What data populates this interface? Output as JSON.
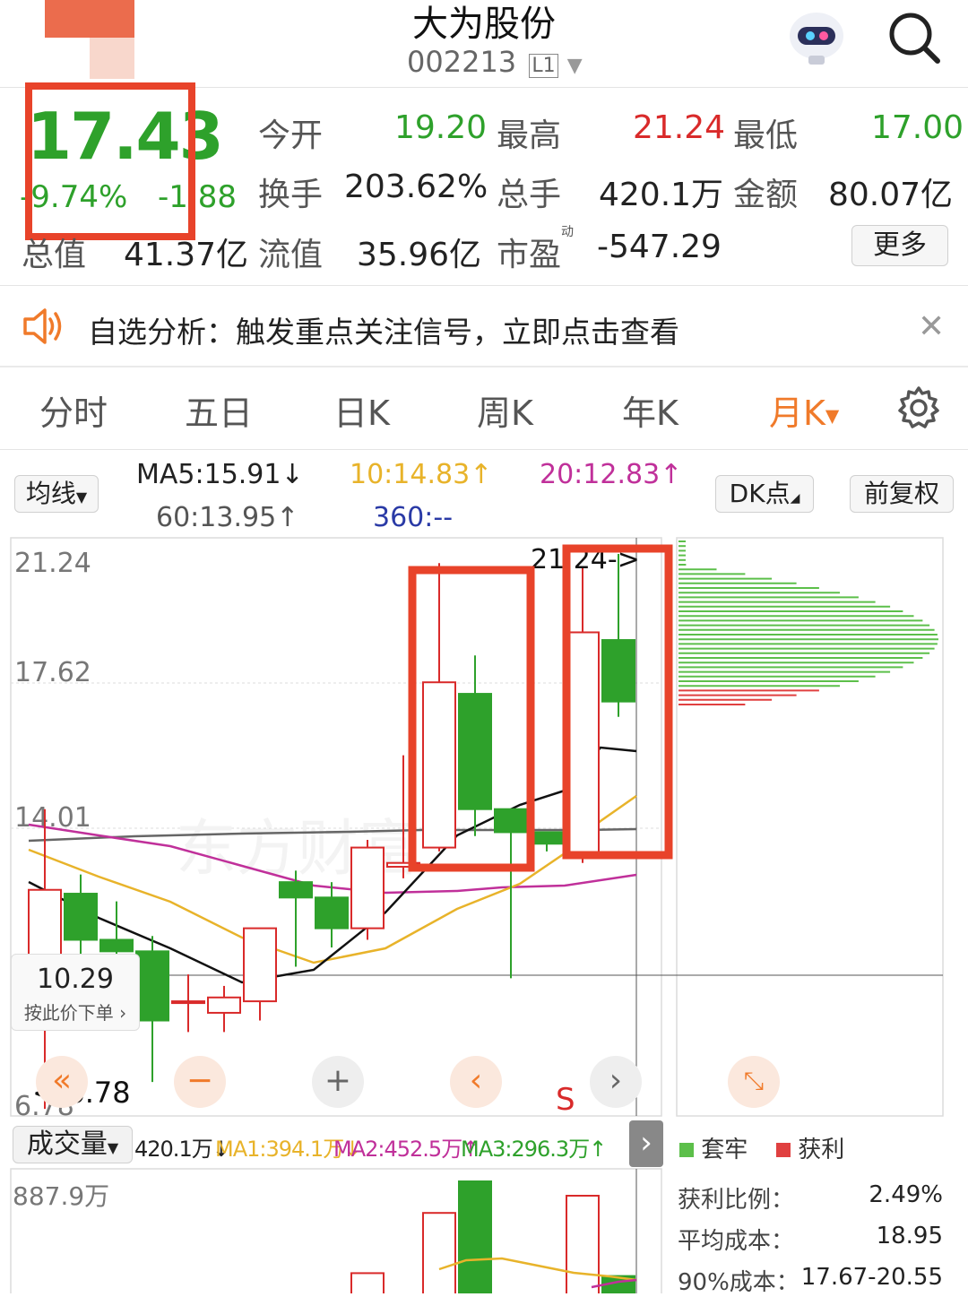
{
  "header": {
    "title": "大为股份",
    "code": "002213",
    "level_badge": "L1"
  },
  "quote": {
    "price": "17.43",
    "change_pct": "-9.74%",
    "change": "-1.88",
    "stats": [
      {
        "label": "今开",
        "value": "19.20",
        "color": "green"
      },
      {
        "label": "最高",
        "value": "21.24",
        "color": "red"
      },
      {
        "label": "最低",
        "value": "17.00",
        "color": "green"
      },
      {
        "label": "换手",
        "value": "203.62%",
        "color": "black"
      },
      {
        "label": "总手",
        "value": "420.1万",
        "color": "black"
      },
      {
        "label": "金额",
        "value": "80.07亿",
        "color": "black"
      },
      {
        "label": "总值",
        "value": "41.37亿",
        "color": "black"
      },
      {
        "label": "流值",
        "value": "35.96亿",
        "color": "black"
      },
      {
        "label": "市盈",
        "value": "-547.29",
        "color": "black"
      }
    ],
    "pe_superscript": "动",
    "more_label": "更多"
  },
  "notice": {
    "text": "自选分析：触发重点关注信号，立即点击查看"
  },
  "tabs": [
    "分时",
    "五日",
    "日K",
    "周K",
    "年K",
    "月K"
  ],
  "active_tab": "月K",
  "indicator_bar": {
    "ma_selector": "均线",
    "ma5": "MA5:15.91↓",
    "ma10": "10:14.83↑",
    "ma20": "20:12.83↑",
    "ma60": "60:13.95↑",
    "ma360": "360:--",
    "dk_label": "DK点",
    "adjust_label": "前复权"
  },
  "chart": {
    "y_labels": [
      "21.24",
      "17.62",
      "14.01",
      "6.78"
    ],
    "high_marker": "21.24->",
    "low_marker": "<-6.78",
    "watermark": "东方财富",
    "tooltip_price": "10.29",
    "tooltip_action": "按此价下单",
    "s_marker": "S"
  },
  "volume": {
    "selector": "成交量",
    "vol": "420.1万↓",
    "ma1": "MA1:394.1万↓",
    "ma2": "MA2:452.5万↑",
    "ma3": "MA3:296.3万↑",
    "max_label": "887.9万"
  },
  "chip": {
    "legend_trapped": "套牢",
    "legend_profit": "获利",
    "rows": [
      {
        "label": "获利比例：",
        "value": "2.49%"
      },
      {
        "label": "平均成本：",
        "value": "18.95"
      },
      {
        "label": "90%成本：",
        "value": "17.67-20.55"
      }
    ]
  },
  "colors": {
    "up": "#d92a2a",
    "down": "#2ea12b",
    "accent": "#f07a2a",
    "highlight_box": "#e8432a"
  },
  "chart_data": {
    "type": "candlestick",
    "y_axis": {
      "min": 6.78,
      "max": 21.24,
      "ticks": [
        21.24,
        17.62,
        14.01,
        6.78
      ]
    },
    "candles": [
      {
        "open": 10.0,
        "close": 12.5,
        "high": 14.6,
        "low": 6.8
      },
      {
        "open": 12.4,
        "close": 11.2,
        "high": 12.9,
        "low": 9.9
      },
      {
        "open": 11.2,
        "close": 10.9,
        "high": 12.2,
        "low": 9.5
      },
      {
        "open": 10.9,
        "close": 9.1,
        "high": 11.3,
        "low": 7.5
      },
      {
        "open": 9.6,
        "close": 9.6,
        "high": 10.3,
        "low": 8.8
      },
      {
        "open": 9.3,
        "close": 9.7,
        "high": 10.0,
        "low": 8.8
      },
      {
        "open": 9.6,
        "close": 11.5,
        "high": 11.5,
        "low": 9.1
      },
      {
        "open": 12.7,
        "close": 12.3,
        "high": 13.0,
        "low": 10.5
      },
      {
        "open": 12.3,
        "close": 11.5,
        "high": 12.7,
        "low": 11.0
      },
      {
        "open": 11.5,
        "close": 13.6,
        "high": 13.8,
        "low": 11.2
      },
      {
        "open": 13.1,
        "close": 13.2,
        "high": 16.0,
        "low": 12.8
      },
      {
        "open": 13.6,
        "close": 17.9,
        "high": 21.0,
        "low": 13.5
      },
      {
        "open": 17.6,
        "close": 14.6,
        "high": 18.6,
        "low": 13.9
      },
      {
        "open": 14.6,
        "close": 14.0,
        "high": 14.6,
        "low": 10.2
      },
      {
        "open": 14.0,
        "close": 13.7,
        "high": 14.0,
        "low": 13.5
      },
      {
        "open": 13.4,
        "close": 19.2,
        "high": 20.9,
        "low": 13.2
      },
      {
        "open": 19.0,
        "close": 17.4,
        "high": 21.24,
        "low": 17.0
      }
    ],
    "volume": [
      0,
      0,
      0,
      0,
      0,
      0,
      0,
      0,
      0,
      130,
      0,
      340,
      450,
      0,
      0,
      400,
      120
    ]
  }
}
